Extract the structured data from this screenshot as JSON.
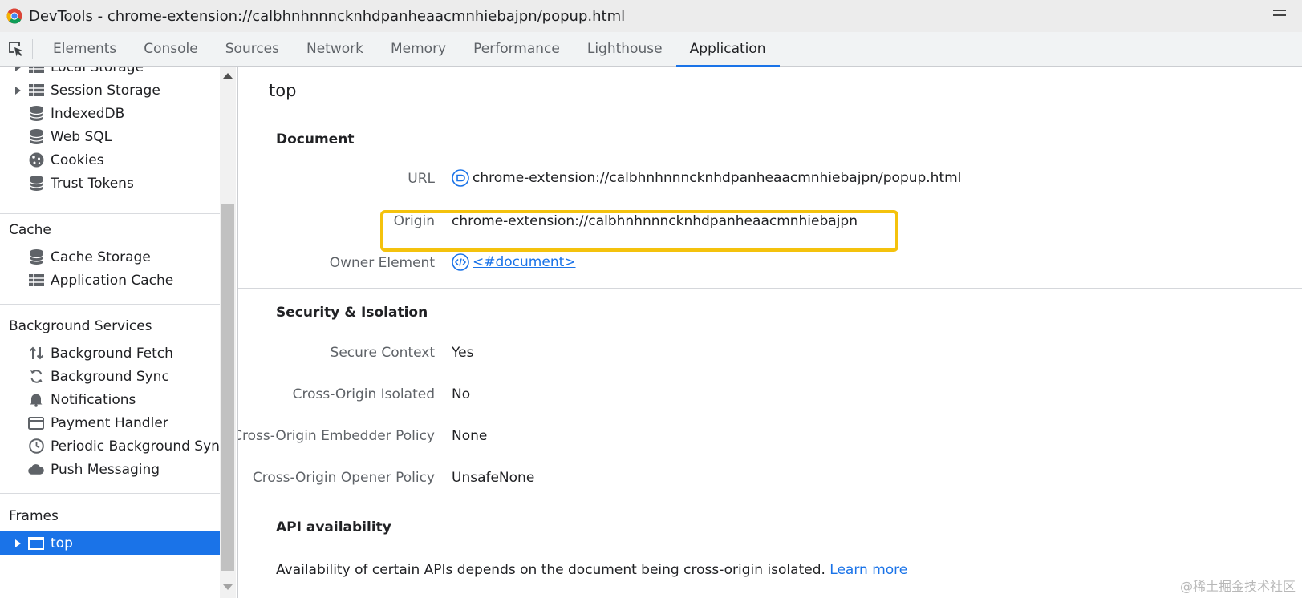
{
  "window": {
    "title": "DevTools - chrome-extension://calbhnhnnncknhdpanheaacmnhiebajpn/popup.html"
  },
  "tabs": [
    {
      "label": "Elements"
    },
    {
      "label": "Console"
    },
    {
      "label": "Sources"
    },
    {
      "label": "Network"
    },
    {
      "label": "Memory"
    },
    {
      "label": "Performance"
    },
    {
      "label": "Lighthouse"
    },
    {
      "label": "Application",
      "active": true
    }
  ],
  "sidebar": {
    "storage_items": [
      {
        "label": "Local Storage",
        "icon": "grid-icon"
      },
      {
        "label": "Session Storage",
        "icon": "grid-icon"
      },
      {
        "label": "IndexedDB",
        "icon": "database-icon"
      },
      {
        "label": "Web SQL",
        "icon": "database-icon"
      },
      {
        "label": "Cookies",
        "icon": "cookie-icon"
      },
      {
        "label": "Trust Tokens",
        "icon": "database-icon"
      }
    ],
    "cache_heading": "Cache",
    "cache_items": [
      {
        "label": "Cache Storage",
        "icon": "database-icon"
      },
      {
        "label": "Application Cache",
        "icon": "grid-icon"
      }
    ],
    "background_heading": "Background Services",
    "background_items": [
      {
        "label": "Background Fetch",
        "icon": "fetch-arrows-icon"
      },
      {
        "label": "Background Sync",
        "icon": "sync-icon"
      },
      {
        "label": "Notifications",
        "icon": "bell-icon"
      },
      {
        "label": "Payment Handler",
        "icon": "card-icon"
      },
      {
        "label": "Periodic Background Sync",
        "icon": "clock-icon"
      },
      {
        "label": "Push Messaging",
        "icon": "cloud-icon"
      }
    ],
    "frames_heading": "Frames",
    "frames_items": [
      {
        "label": "top",
        "icon": "frame-icon",
        "selected": true
      }
    ]
  },
  "main": {
    "title": "top",
    "document": {
      "heading": "Document",
      "url_label": "URL",
      "url_value": "chrome-extension://calbhnhnnncknhdpanheaacmnhiebajpn/popup.html",
      "origin_label": "Origin",
      "origin_value": "chrome-extension://calbhnhnnncknhdpanheaacmnhiebajpn",
      "owner_label": "Owner Element",
      "owner_value": "<#document>"
    },
    "security": {
      "heading": "Security & Isolation",
      "rows": [
        {
          "label": "Secure Context",
          "value": "Yes"
        },
        {
          "label": "Cross-Origin Isolated",
          "value": "No"
        },
        {
          "label": "Cross-Origin Embedder Policy",
          "value": "None"
        },
        {
          "label": "Cross-Origin Opener Policy",
          "value": "UnsafeNone"
        }
      ]
    },
    "api": {
      "heading": "API availability",
      "description": "Availability of certain APIs depends on the document being cross-origin isolated.",
      "learn_more": "Learn more"
    }
  },
  "watermark": "@稀土掘金技术社区",
  "colors": {
    "accent": "#1a73e8",
    "highlight_border": "#f4c20d",
    "selected_bg": "#1a73e8"
  }
}
